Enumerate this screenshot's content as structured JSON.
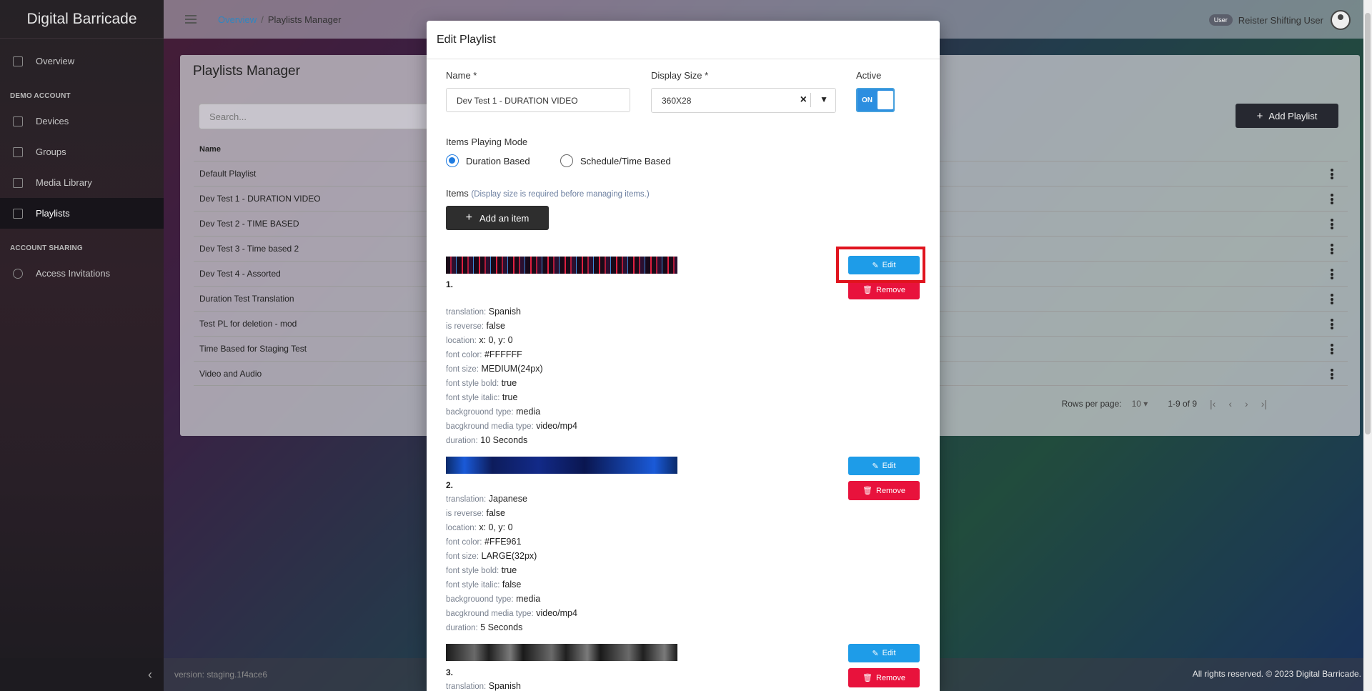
{
  "app": {
    "brand": "Digital Barricade"
  },
  "sidebar": {
    "overview": "Overview",
    "section_demo": "DEMO ACCOUNT",
    "devices": "Devices",
    "groups": "Groups",
    "media_library": "Media Library",
    "playlists": "Playlists",
    "section_sharing": "ACCOUNT SHARING",
    "access_invitations": "Access Invitations",
    "collapse_glyph": "‹"
  },
  "header": {
    "crumb_root": "Overview",
    "crumb_sep": "/",
    "crumb_current": "Playlists Manager",
    "user_badge": "User",
    "user_name": "Reister Shifting User"
  },
  "page": {
    "title": "Playlists Manager",
    "search_placeholder": "Search...",
    "add_playlist": "Add Playlist",
    "col_name": "Name",
    "rows": [
      "Default Playlist",
      "Dev Test 1 - DURATION VIDEO",
      "Dev Test 2 - TIME BASED",
      "Dev Test 3 - Time based 2",
      "Dev Test 4 - Assorted",
      "Duration Test Translation",
      "Test PL for deletion - mod",
      "Time Based for Staging Test",
      "Video and Audio"
    ],
    "rows_per_page_label": "Rows per page:",
    "rows_per_page_value": "10",
    "range": "1-9 of 9"
  },
  "footer": {
    "version": "version: staging.1f4ace6",
    "copyright": "All rights reserved. © 2023 Digital Barricade."
  },
  "modal": {
    "title": "Edit Playlist",
    "name_label": "Name *",
    "name_value": "Dev Test 1 - DURATION VIDEO",
    "display_size_label": "Display Size *",
    "display_size_value": "360X28",
    "active_label": "Active",
    "active_state": "ON",
    "mode_label": "Items Playing Mode",
    "mode_duration": "Duration Based",
    "mode_schedule": "Schedule/Time Based",
    "items_label": "Items",
    "items_hint": "(Display size is required before managing items.)",
    "add_item": "Add an item",
    "edit_label": "Edit",
    "remove_label": "Remove",
    "items": [
      {
        "num": "1.",
        "translation": "Spanish",
        "is_reverse": "false",
        "location": "x: 0, y: 0",
        "font_color": "#FFFFFF",
        "font_size": "MEDIUM(24px)",
        "bold": "true",
        "italic": "true",
        "bg_type": "media",
        "bg_media_type": "video/mp4",
        "duration": "10 Seconds"
      },
      {
        "num": "2.",
        "translation": "Japanese",
        "is_reverse": "false",
        "location": "x: 0, y: 0",
        "font_color": "#FFE961",
        "font_size": "LARGE(32px)",
        "bold": "true",
        "italic": "false",
        "bg_type": "media",
        "bg_media_type": "video/mp4",
        "duration": "5 Seconds"
      },
      {
        "num": "3.",
        "translation": "Spanish"
      }
    ],
    "keys": {
      "translation": "translation:",
      "is_reverse": "is reverse:",
      "location": "location:",
      "font_color": "font color:",
      "font_size": "font size:",
      "bold": "font style bold:",
      "italic": "font style italic:",
      "bg_type": "backgrouond type:",
      "bg_media_type": "bacgkround media type:",
      "duration": "duration:"
    }
  },
  "colors": {
    "accent_blue": "#1e9ce8",
    "danger_red": "#e8123c",
    "highlight_red": "#e0141e"
  }
}
